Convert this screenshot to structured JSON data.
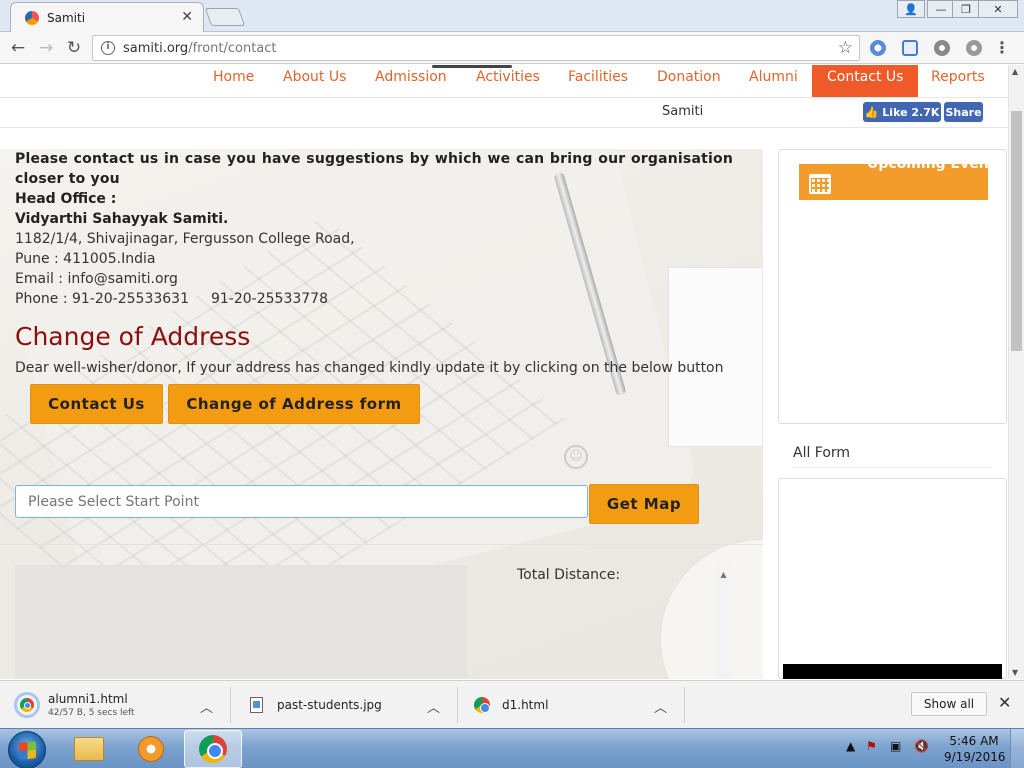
{
  "browser": {
    "tab_title": "Samiti",
    "tab_close": "✕",
    "url_host": "samiti.org",
    "url_path": "/front/contact",
    "window_controls": {
      "minimize": "—",
      "maximize": "❐",
      "close": "✕",
      "user": "👤"
    }
  },
  "nav": {
    "items": [
      {
        "label": "Home"
      },
      {
        "label": "About Us"
      },
      {
        "label": "Admission"
      },
      {
        "label": "Activities"
      },
      {
        "label": "Facilities"
      },
      {
        "label": "Donation"
      },
      {
        "label": "Alumni"
      },
      {
        "label": "Contact Us",
        "active": true
      },
      {
        "label": "Reports"
      }
    ]
  },
  "subbar": {
    "site_name": "Samiti",
    "fb_like": "Like 2.7K",
    "fb_share": "Share"
  },
  "contact": {
    "intro": "Please contact us in case you have suggestions by which we can bring our organisation closer to you",
    "head_office_label": "Head Office :",
    "org_name": "Vidyarthi Sahayyak Samiti.",
    "address": "1182/1/4, Shivajinagar, Fergusson College Road,",
    "city": "Pune : 411005.India",
    "email": "Email : info@samiti.org",
    "phone": "Phone : 91-20-25533631",
    "phone2": "91-20-25533778"
  },
  "change_of_address": {
    "title": "Change of Address",
    "description": "Dear well-wisher/donor, If your address has changed kindly update it by clicking on the below button",
    "contact_button": "Contact Us",
    "form_button": "Change of Address form"
  },
  "map": {
    "start_placeholder": "Please Select Start Point",
    "get_map_button": "Get Map",
    "total_distance_label": "Total Distance:"
  },
  "sidebar": {
    "upcoming_title": "Upcoming Even",
    "all_form_title": "All Form"
  },
  "downloads": {
    "items": [
      {
        "name": "alumni1.html",
        "status": "42/57 B, 5 secs left"
      },
      {
        "name": "past-students.jpg"
      },
      {
        "name": "d1.html"
      }
    ],
    "show_all": "Show all"
  },
  "taskbar": {
    "time": "5:46 AM",
    "date": "9/19/2016"
  },
  "colors": {
    "accent_orange": "#f39c12",
    "nav_active": "#f05a28",
    "nav_text": "#e0652c",
    "heading_red": "#8b0f0f",
    "facebook_blue": "#4267b2"
  }
}
